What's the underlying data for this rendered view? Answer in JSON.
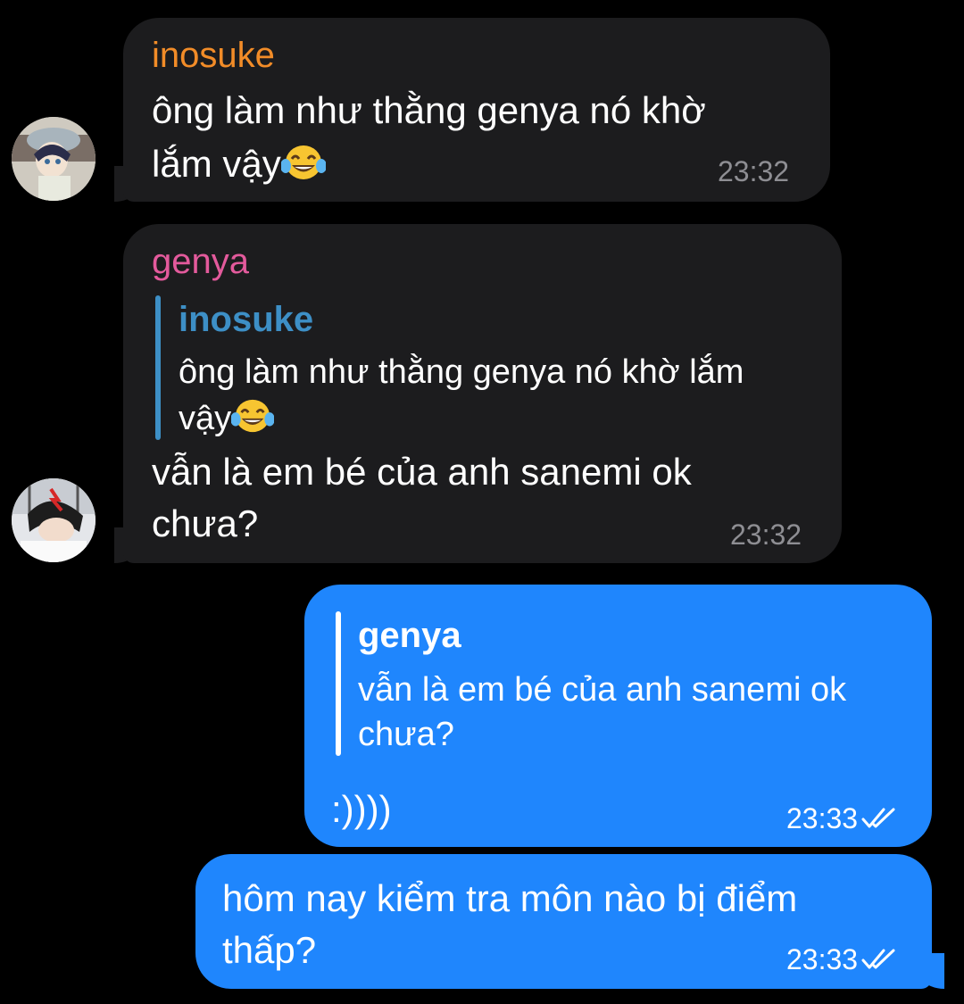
{
  "messages": [
    {
      "sender": "inosuke",
      "sender_color": "#f28c28",
      "text": "ông làm như thằng genya nó khờ lắm vậy😂",
      "line1": "ông làm như thằng genya nó khờ",
      "line2": "lắm vậy",
      "time": "23:32"
    },
    {
      "sender": "genya",
      "sender_color": "#e35a9c",
      "reply_to": {
        "sender": "inosuke",
        "text_line1": "ông làm như thằng genya nó khờ lắm",
        "text_line2": "vậy",
        "color": "#3d8fc6"
      },
      "line1": "vẫn là em bé của anh sanemi ok",
      "line2": "chưa?",
      "time": "23:32"
    },
    {
      "outgoing": true,
      "reply_to": {
        "sender": "genya",
        "text_line1": "vẫn là em bé của anh sanemi ok",
        "text_line2": "chưa?"
      },
      "text": ":))))",
      "time": "23:33",
      "status": "read"
    },
    {
      "outgoing": true,
      "line1": "hôm nay kiểm tra môn nào bị điểm",
      "line2": "thấp?",
      "time": "23:33",
      "status": "read"
    }
  ],
  "colors": {
    "background": "#000000",
    "incoming_bubble": "#1c1c1e",
    "outgoing_bubble": "#1f86fd"
  },
  "icons": {
    "emoji": "face-with-tears-of-joy",
    "status": "double-check-icon"
  }
}
